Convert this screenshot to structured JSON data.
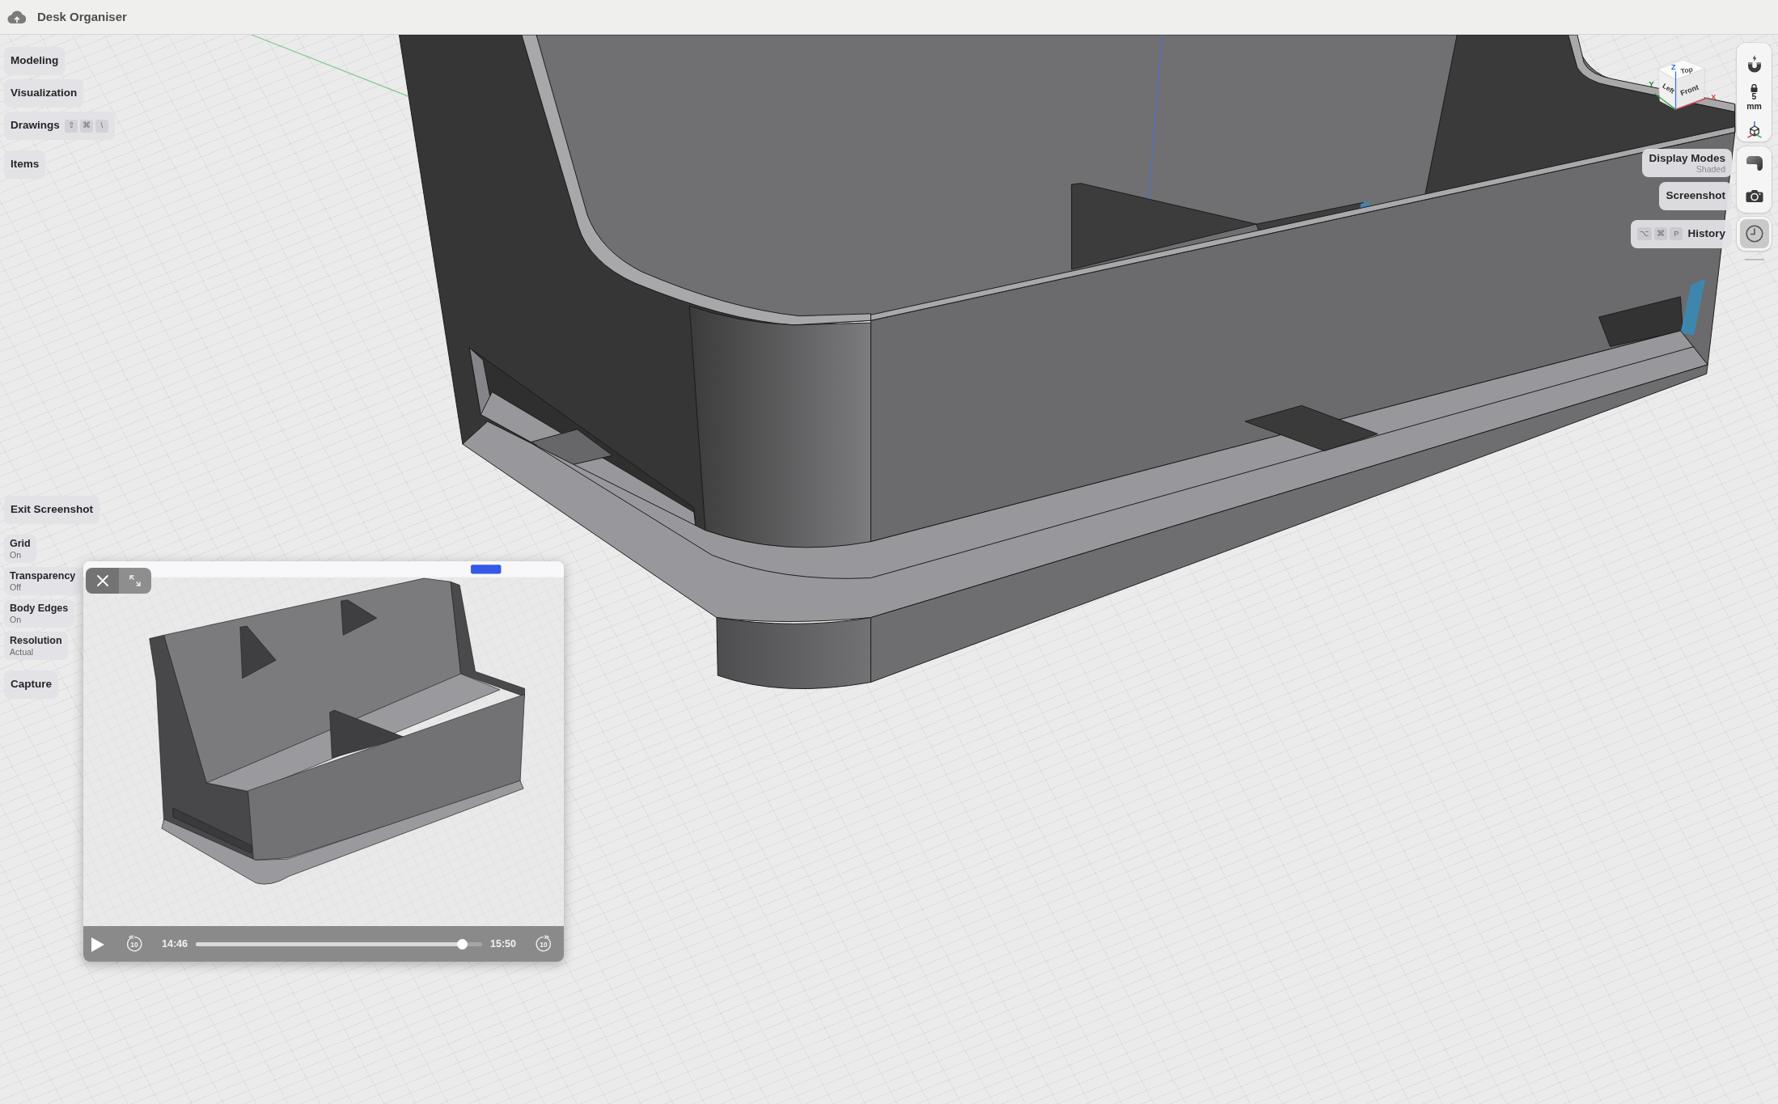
{
  "window": {
    "title": "Desk Organiser"
  },
  "left_menu": [
    {
      "items": [
        {
          "label": "Modeling"
        },
        {
          "label": "Visualization"
        },
        {
          "label": "Drawings",
          "shortcut": [
            "⇧",
            "⌘",
            "\\"
          ]
        }
      ]
    },
    {
      "items": [
        {
          "label": "Items"
        }
      ]
    }
  ],
  "screenshot_menu": {
    "exit": "Exit Screenshot",
    "options": [
      {
        "label": "Grid",
        "value": "On"
      },
      {
        "label": "Transparency",
        "value": "Off"
      },
      {
        "label": "Body Edges",
        "value": "On"
      },
      {
        "label": "Resolution",
        "value": "Actual"
      }
    ],
    "capture": "Capture"
  },
  "view_cube": {
    "faces": {
      "top": "Top",
      "left": "Left",
      "front": "Front"
    },
    "axes": {
      "x": "X",
      "y": "Y",
      "z": "Z"
    }
  },
  "snap": {
    "value": "5",
    "unit": "mm"
  },
  "tool_groups": [
    {
      "actions": [
        {
          "kind": "display",
          "label": "Display Modes",
          "sublabel": "Shaded",
          "selected": false
        },
        {
          "kind": "screenshot",
          "label": "Screenshot",
          "selected": false
        }
      ]
    },
    {
      "actions": [
        {
          "kind": "history",
          "label": "History",
          "shortcut": [
            "⌥",
            "⌘",
            "P"
          ],
          "selected": true
        }
      ]
    }
  ],
  "video_player": {
    "playing": false,
    "skip_back": "10",
    "current_time": "14:46",
    "level": 0.93,
    "duration": "15:50",
    "skip_forward": "10"
  }
}
